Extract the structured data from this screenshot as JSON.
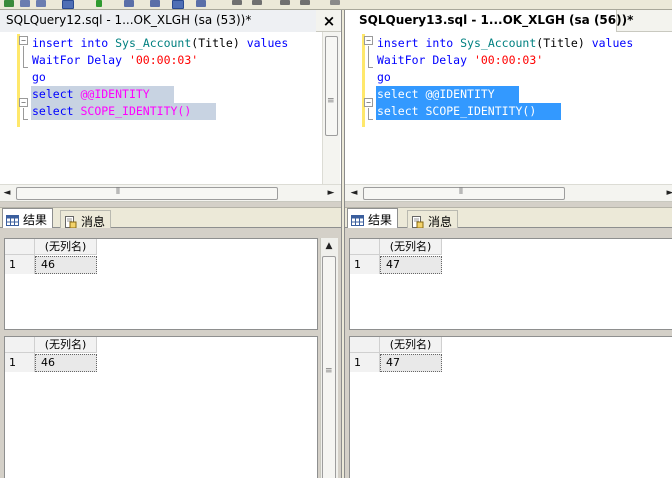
{
  "left_pane": {
    "tab_title": "SQLQuery12.sql - 1...OK_XLGH (sa (53))*",
    "close_glyph": "×",
    "code": {
      "line1": {
        "kw1": "insert",
        "kw2": "into",
        "obj": "Sys_Account",
        "rest": "(Title)",
        "kw3": "values"
      },
      "line2": {
        "kw": "WaitFor Delay",
        "str": "'00:00:03'"
      },
      "line3": {
        "kw": "go"
      },
      "line4": {
        "kw": "select",
        "fn": "@@IDENTITY"
      },
      "line5": {
        "kw": "select",
        "fn": "SCOPE_IDENTITY()"
      }
    },
    "results_tab": "结果",
    "messages_tab": "消息",
    "grids": [
      {
        "column": "(无列名)",
        "row_number": "1",
        "value": "46"
      },
      {
        "column": "(无列名)",
        "row_number": "1",
        "value": "46"
      }
    ]
  },
  "right_pane": {
    "tab_title": "SQLQuery13.sql - 1...OK_XLGH (sa (56))*",
    "code": {
      "line1": {
        "kw1": "insert",
        "kw2": "into",
        "obj": "Sys_Account",
        "rest": "(Title)",
        "kw3": "values"
      },
      "line2": {
        "kw": "WaitFor Delay",
        "str": "'00:00:03'"
      },
      "line3": {
        "kw": "go"
      },
      "line4": {
        "kw": "select",
        "fn": "@@IDENTITY"
      },
      "line5": {
        "kw": "select",
        "fn": "SCOPE_IDENTITY()"
      }
    },
    "results_tab": "结果",
    "messages_tab": "消息",
    "grids": [
      {
        "column": "(无列名)",
        "row_number": "1",
        "value": "47"
      },
      {
        "column": "(无列名)",
        "row_number": "1",
        "value": "47"
      }
    ]
  },
  "scroll_arrows": {
    "left": "◄",
    "right": "►",
    "up": "▲",
    "down": "▼",
    "grip": "≡"
  },
  "colors": {
    "keyword": "#0000ff",
    "function": "#ff00ff",
    "object": "#008080",
    "string": "#ff0000",
    "inactive_selection": "#c8d3e2",
    "active_selection": "#3399ff"
  }
}
